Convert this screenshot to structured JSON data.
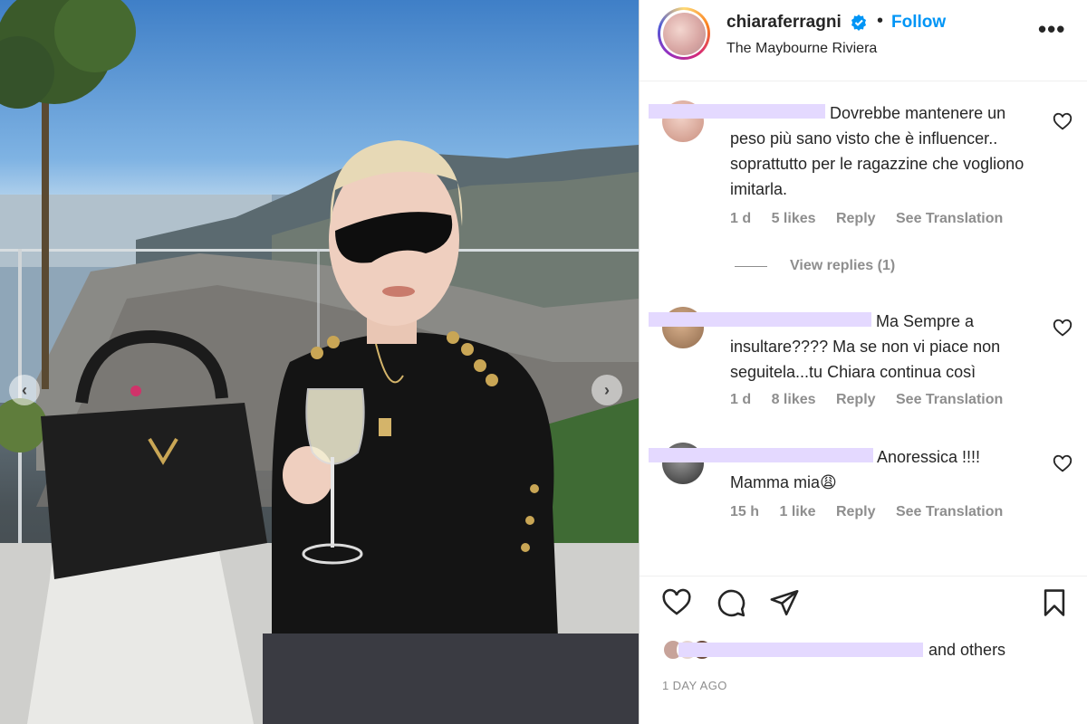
{
  "post": {
    "username": "chiaraferragni",
    "separator": "•",
    "follow_label": "Follow",
    "location": "The Maybourne Riviera",
    "more_label": "•••",
    "verified_icon": "verified-badge-icon"
  },
  "carousel": {
    "prev_label": "‹",
    "next_label": "›"
  },
  "comments": [
    {
      "text": "Dovrebbe mantenere un peso più sano visto che è influencer.. soprattutto per le ragazzine che vogliono imitarla.",
      "time": "1 d",
      "likes": "5 likes",
      "reply": "Reply",
      "translate": "See Translation",
      "view_replies": "View replies (1)",
      "avatar_color": "#d9a89a"
    },
    {
      "text": "Ma Sempre a insultare???? Ma se non vi piace non seguitela...tu Chiara continua così",
      "time": "1 d",
      "likes": "8 likes",
      "reply": "Reply",
      "translate": "See Translation",
      "avatar_color": "#b88a6a"
    },
    {
      "text": "Anoressica !!!! Mamma mia😩",
      "time": "15 h",
      "likes": "1 like",
      "reply": "Reply",
      "translate": "See Translation",
      "avatar_color": "#4a4a4a"
    }
  ],
  "actions": {
    "like_icon": "heart-icon",
    "comment_icon": "comment-icon",
    "share_icon": "share-icon",
    "save_icon": "bookmark-icon"
  },
  "likes_text": "and others",
  "time_ago": "1 DAY AGO"
}
